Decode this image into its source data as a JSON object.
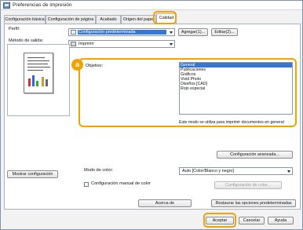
{
  "window": {
    "title": "Preferencias de impresión"
  },
  "tabs": [
    {
      "label": "Configuración básica"
    },
    {
      "label": "Configuración de página"
    },
    {
      "label": "Acabado"
    },
    {
      "label": "Origen del papel"
    },
    {
      "label": "Calidad"
    }
  ],
  "profile": {
    "label": "Perfil:",
    "value": "Configuración predeterminada",
    "add_button": "Agregar(1)...",
    "edit_button": "Editar(2)..."
  },
  "output": {
    "label": "Método de salida:",
    "value": "Imprimir"
  },
  "callout": {
    "badge": "a"
  },
  "objective": {
    "label": "Objetivo:",
    "options": [
      "General",
      "Publicaciones",
      "Gráficos",
      "Vivid Photo",
      "Diseños [CAD]",
      "Rojo especial"
    ],
    "selected": "General",
    "description": "Este modo se utiliza para imprimir documentos en general"
  },
  "buttons": {
    "advanced": "Configuración avanzada...",
    "show_settings": "Mostrar configuración",
    "color_settings": "Configuración de color...",
    "about": "Acerca de",
    "restore_defaults": "Restaurar las opciones predeterminadas",
    "ok": "Aceptar",
    "cancel": "Cancelar",
    "help": "Ayuda"
  },
  "color": {
    "mode_label": "Modo de color:",
    "mode_value": "Auto [Color/Blanco y negro]",
    "manual_label": "Configuración manual de color"
  },
  "colors": {
    "accent": "#f4a200",
    "selection": "#3876d3"
  }
}
